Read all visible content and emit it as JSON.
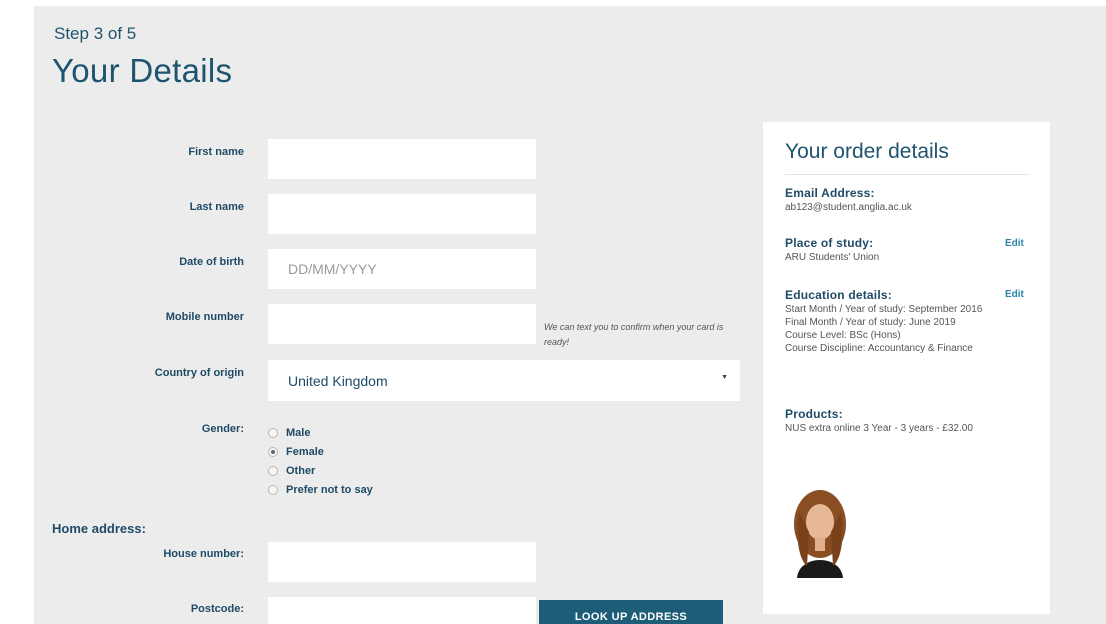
{
  "header": {
    "step": "Step 3 of 5",
    "title": "Your Details"
  },
  "form": {
    "first_name": {
      "label": "First name",
      "value": ""
    },
    "last_name": {
      "label": "Last name",
      "value": ""
    },
    "dob": {
      "label": "Date of birth",
      "placeholder": "DD/MM/YYYY"
    },
    "mobile": {
      "label": "Mobile number",
      "hint": "We can text you to confirm when your card is ready!"
    },
    "country": {
      "label": "Country of origin",
      "value": "United Kingdom"
    },
    "gender": {
      "label": "Gender:",
      "options": [
        "Male",
        "Female",
        "Other",
        "Prefer not to say"
      ],
      "selected": "Female"
    },
    "home_address": {
      "heading": "Home address:",
      "house_number": {
        "label": "House number:"
      },
      "postcode": {
        "label": "Postcode:"
      },
      "lookup_button": "LOOK UP ADDRESS"
    }
  },
  "order": {
    "title": "Your order details",
    "email": {
      "heading": "Email Address:",
      "value": "ab123@student.anglia.ac.uk"
    },
    "place": {
      "heading": "Place of study:",
      "value": "ARU Students' Union",
      "edit": "Edit"
    },
    "education": {
      "heading": "Education details:",
      "edit": "Edit",
      "lines": [
        "Start Month / Year of study: September 2016",
        "Final Month / Year of study: June 2019",
        "Course Level: BSc (Hons)",
        "Course Discipline: Accountancy & Finance"
      ]
    },
    "products": {
      "heading": "Products:",
      "value": "NUS extra online 3 Year - 3 years - £32.00"
    }
  },
  "colors": {
    "brand": "#1f5470",
    "button": "#1d5d78",
    "link": "#2b84a8",
    "background": "#ececec"
  }
}
